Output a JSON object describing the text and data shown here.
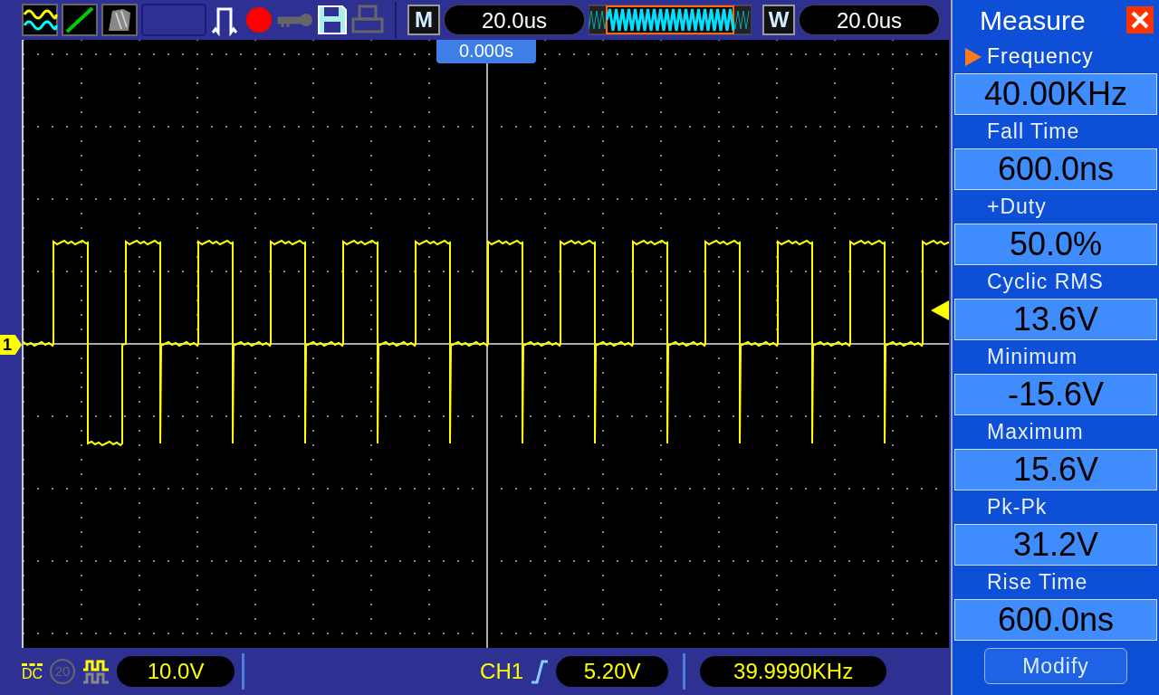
{
  "toolbar": {
    "recording": true,
    "timebase_label": "M",
    "timebase": "20.0us",
    "window_label": "W",
    "window_timebase": "20.0us"
  },
  "screen": {
    "trigger_position": "0.000s",
    "channel_marker": "1"
  },
  "measure_panel": {
    "title": "Measure",
    "measurements": [
      {
        "label": "Frequency",
        "value": "40.00KHz",
        "selected": true
      },
      {
        "label": "Fall Time",
        "value": "600.0ns",
        "selected": false
      },
      {
        "label": "+Duty",
        "value": "50.0%",
        "selected": false
      },
      {
        "label": "Cyclic RMS",
        "value": "13.6V",
        "selected": false
      },
      {
        "label": "Minimum",
        "value": "-15.6V",
        "selected": false
      },
      {
        "label": "Maximum",
        "value": "15.6V",
        "selected": false
      },
      {
        "label": "Pk-Pk",
        "value": "31.2V",
        "selected": false
      },
      {
        "label": "Rise Time",
        "value": "600.0ns",
        "selected": false
      }
    ],
    "modify_button": "Modify"
  },
  "status_bar": {
    "coupling": "DC",
    "bandwidth_limit": {
      "label": "20",
      "on": false
    },
    "volts_per_div": "10.0V",
    "trigger_source": "CH1",
    "trigger_level": "5.20V",
    "frequency": "39.9990KHz"
  }
}
